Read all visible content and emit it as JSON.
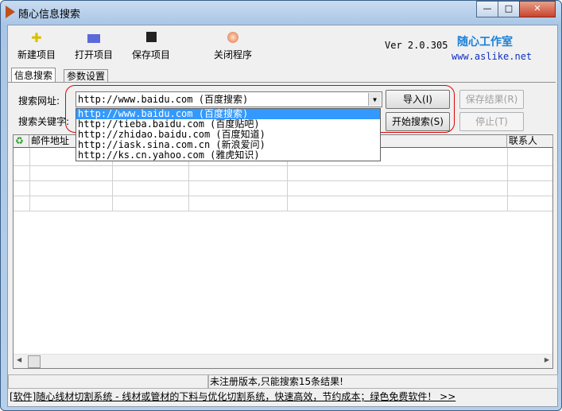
{
  "window": {
    "title": "随心信息搜索",
    "min": "—",
    "max": "□",
    "close": "✕"
  },
  "toolbar": {
    "new": "新建项目",
    "open": "打开项目",
    "save": "保存项目",
    "close": "关闭程序"
  },
  "version": "Ver 2.0.305",
  "brand": {
    "name": "随心工作室",
    "url": "www.aslike.net"
  },
  "tabs": [
    {
      "label": "信息搜索"
    },
    {
      "label": "参数设置"
    }
  ],
  "form": {
    "url_label": "搜索网址:",
    "keyword_label": "搜索关键字:",
    "url_value": "http://www.baidu.com (百度搜索)",
    "options": [
      "http://www.baidu.com (百度搜索)",
      "http://tieba.baidu.com (百度贴吧)",
      "http://zhidao.baidu.com (百度知道)",
      "http://iask.sina.com.cn (新浪爱问)",
      "http://ks.cn.yahoo.com (雅虎知识)"
    ]
  },
  "buttons": {
    "import": "导入(I)",
    "start": "开始搜索(S)",
    "save_result": "保存结果(R)",
    "stop": "停止(T)"
  },
  "grid": {
    "columns": [
      "邮件地址",
      "",
      "",
      "",
      "联系人"
    ]
  },
  "status": {
    "left": "",
    "message": "未注册版本,只能搜索15条结果!"
  },
  "ad": "[软件]随心线材切割系统 - 线材或管材的下料与优化切割系统，快速高效，节约成本；绿色免费软件！ >>"
}
